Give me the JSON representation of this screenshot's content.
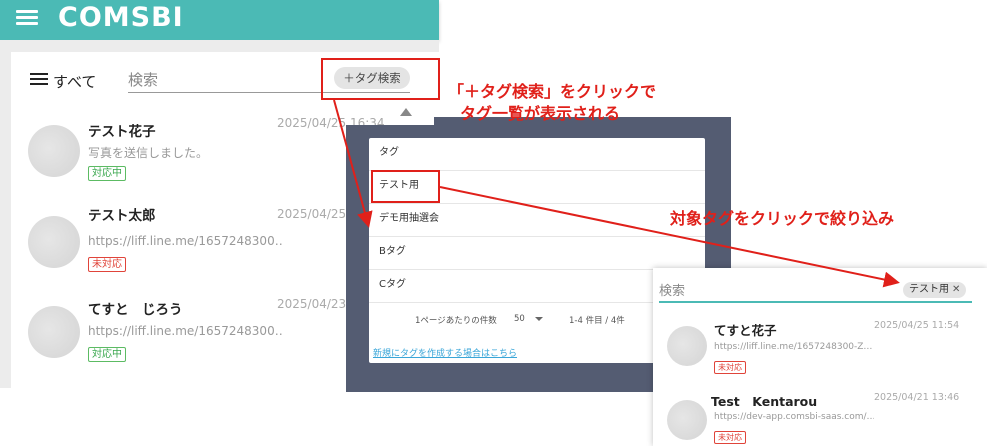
{
  "header": {
    "logo": "COMSBI"
  },
  "left": {
    "all_label": "すべて",
    "search_placeholder": "検索",
    "tag_search_label": "＋タグ検索",
    "conversations": [
      {
        "name": "テスト花子",
        "message": "写真を送信しました。",
        "date": "2025/04/25 16:34",
        "status": "対応中"
      },
      {
        "name": "テスト太郎",
        "message": "https://liff.line.me/1657248300…",
        "date": "2025/04/25",
        "status": "未対応"
      },
      {
        "name": "てすと　じろう",
        "message": "https://liff.line.me/1657248300…",
        "date": "2025/04/23",
        "status": "対応中"
      }
    ]
  },
  "popup": {
    "header": "タグ",
    "tags": [
      "テスト用",
      "デモ用抽選会",
      "Bタグ",
      "Cタグ"
    ],
    "rows_per_page_label": "1ページあたりの件数",
    "rows_per_page_value": "50",
    "range_label": "1-4 件目 / 4件",
    "create_link": "新規にタグを作成する場合はこちら"
  },
  "right": {
    "search_placeholder": "検索",
    "chip_label": "テスト用",
    "chip_close": "✕",
    "conversations": [
      {
        "name": "てすと花子",
        "message": "https://liff.line.me/1657248300-Z…",
        "date": "2025/04/25 11:54",
        "status": "未対応"
      },
      {
        "name": "Test　Kentarou",
        "message": "https://dev-app.comsbi-saas.com/…",
        "date": "2025/04/21 13:46",
        "status": "未対応"
      }
    ]
  },
  "annotations": {
    "callout1_line1": "「＋タグ検索」をクリックで",
    "callout1_line2": "タグ一覧が表示される",
    "callout2": "対象タグをクリックで絞り込み"
  },
  "colors": {
    "brand": "#4bbab5",
    "annotation": "#e0201a",
    "panel_dark": "#545c72"
  }
}
